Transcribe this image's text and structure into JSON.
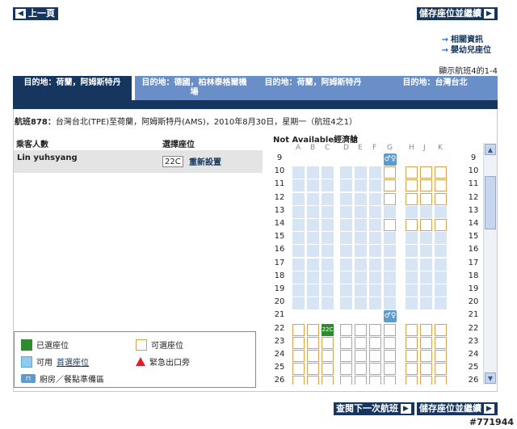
{
  "nav": {
    "back_label": "上一頁",
    "save_continue_label": "儲存座位並繼續",
    "next_flight_label": "查閱下一次航班"
  },
  "links": [
    "相關資訊",
    "嬰幼兒座位"
  ],
  "flight_count_text": "顯示航班4的1-4",
  "tabs": [
    {
      "label": "目的地：荷蘭，阿姆斯特丹"
    },
    {
      "label": "目的地：德國，柏林泰格爾機場"
    },
    {
      "label": "目的地：荷蘭，阿姆斯特丹"
    },
    {
      "label": "目的地：台灣台北"
    }
  ],
  "flight": {
    "number": "航班878：",
    "details": "台灣台北(TPE)至荷蘭，阿姆斯特丹(AMS)，2010年8月30日，星期一（航班4之1）"
  },
  "passenger_table": {
    "col_passenger": "乘客人數",
    "col_seat": "選擇座位",
    "rows": [
      {
        "name": "Lin yuhsyang",
        "seat": "22C",
        "reset": "重新設置"
      }
    ]
  },
  "legend": {
    "selected": "已選座位",
    "available": "可選座位",
    "preferred_prefix": "可用",
    "preferred_link": "首選座位",
    "exit": "緊急出口旁",
    "galley": "廚房／餐點準備區"
  },
  "seatmap": {
    "title": "Not Available經濟艙",
    "columns": [
      "A",
      "B",
      "C",
      "D",
      "E",
      "F",
      "G",
      "H",
      "J",
      "K"
    ],
    "rows": [
      "9",
      "10",
      "11",
      "12",
      "13",
      "14",
      "15",
      "16",
      "17",
      "18",
      "19",
      "20",
      "21",
      "22",
      "23",
      "24",
      "25",
      "26"
    ],
    "selected_seat": "22C"
  },
  "watermark": "#771944",
  "colors": {
    "navy": "#16365f",
    "tab_inactive": "#6a8fc8",
    "selected": "#2e8b2e",
    "available_border": "#d8a050"
  }
}
